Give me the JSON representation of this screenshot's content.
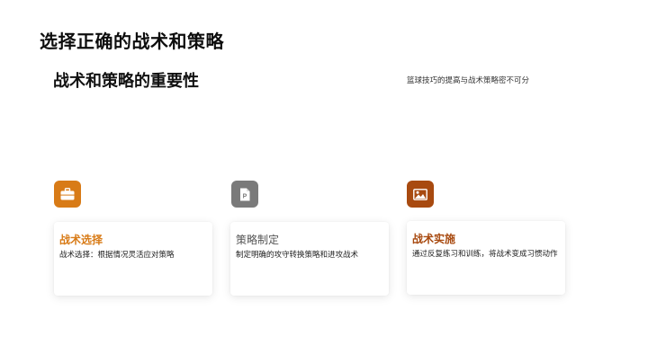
{
  "slide": {
    "title": "选择正确的战术和策略"
  },
  "section": {
    "title": "战术和策略的重要性",
    "subtitle": "篮球技巧的提高与战术策略密不可分"
  },
  "colors": {
    "accent_orange": "#d87b17",
    "gray": "#7a7a7a",
    "dark_orange": "#a84a10"
  },
  "cards": [
    {
      "icon": "briefcase-icon",
      "title": "战术选择",
      "description": "战术选择：根据情况灵活应对策略"
    },
    {
      "icon": "document-p-icon",
      "title": "策略制定",
      "description": "制定明确的攻守转换策略和进攻战术"
    },
    {
      "icon": "image-icon",
      "title": "战术实施",
      "description": "通过反复练习和训练，将战术变成习惯动作"
    }
  ]
}
